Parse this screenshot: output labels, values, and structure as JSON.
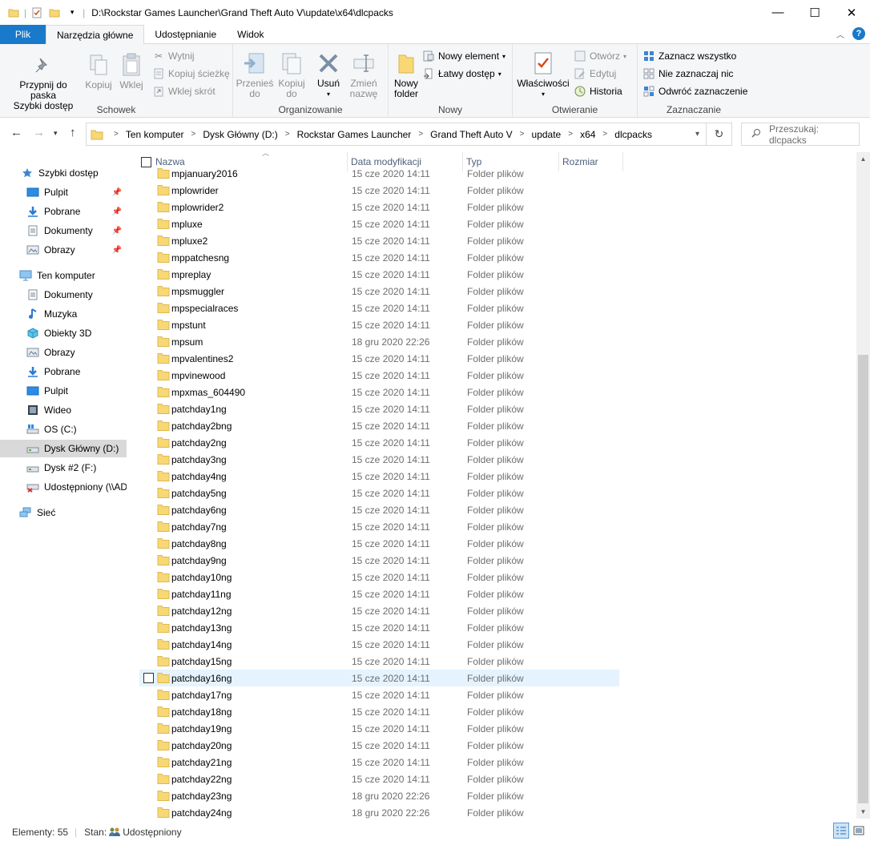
{
  "window": {
    "title": "D:\\Rockstar Games Launcher\\Grand Theft Auto V\\update\\x64\\dlcpacks",
    "controls": {
      "minimize": "—",
      "maximize": "☐",
      "close": "✕"
    }
  },
  "ribbon_tabs": [
    {
      "label": "Plik"
    },
    {
      "label": "Narzędzia główne"
    },
    {
      "label": "Udostępnianie"
    },
    {
      "label": "Widok"
    }
  ],
  "ribbon": {
    "schowek": {
      "label": "Schowek",
      "pin_line1": "Przypnij do paska",
      "pin_line2": "Szybki dostęp",
      "copy": "Kopiuj",
      "paste": "Wklej",
      "cut": "Wytnij",
      "copy_path": "Kopiuj ścieżkę",
      "paste_shortcut": "Wklej skrót"
    },
    "organizowanie": {
      "label": "Organizowanie",
      "move_line1": "Przenieś",
      "move_line2": "do",
      "copy_line1": "Kopiuj",
      "copy_line2": "do",
      "delete": "Usuń",
      "rename_line1": "Zmień",
      "rename_line2": "nazwę"
    },
    "nowy": {
      "label": "Nowy",
      "new_folder_line1": "Nowy",
      "new_folder_line2": "folder",
      "new_item": "Nowy element",
      "easy_access": "Łatwy dostęp"
    },
    "otwieranie": {
      "label": "Otwieranie",
      "properties": "Właściwości",
      "open": "Otwórz",
      "edit": "Edytuj",
      "history": "Historia"
    },
    "zaznaczanie": {
      "label": "Zaznaczanie",
      "select_all": "Zaznacz wszystko",
      "select_none": "Nie zaznaczaj nic",
      "invert": "Odwróć zaznaczenie"
    }
  },
  "address": {
    "crumbs": [
      "Ten komputer",
      "Dysk Główny (D:)",
      "Rockstar Games Launcher",
      "Grand Theft Auto V",
      "update",
      "x64",
      "dlcpacks"
    ],
    "search_placeholder": "Przeszukaj: dlcpacks"
  },
  "nav": {
    "quick_access": "Szybki dostęp",
    "quick_items": [
      "Pulpit",
      "Pobrane",
      "Dokumenty",
      "Obrazy"
    ],
    "this_pc": "Ten komputer",
    "pc_items": [
      "Dokumenty",
      "Muzyka",
      "Obiekty 3D",
      "Obrazy",
      "Pobrane",
      "Pulpit",
      "Wideo",
      "OS (C:)",
      "Dysk Główny (D:)",
      "Dysk #2 (F:)",
      "Udostępniony (\\\\AD"
    ],
    "network": "Sieć"
  },
  "columns": {
    "name": "Nazwa",
    "date": "Data modyfikacji",
    "type": "Typ",
    "size": "Rozmiar"
  },
  "files": [
    {
      "name": "mpjanuary2016",
      "date": "15 cze 2020 14:11",
      "type": "Folder plików"
    },
    {
      "name": "mplowrider",
      "date": "15 cze 2020 14:11",
      "type": "Folder plików"
    },
    {
      "name": "mplowrider2",
      "date": "15 cze 2020 14:11",
      "type": "Folder plików"
    },
    {
      "name": "mpluxe",
      "date": "15 cze 2020 14:11",
      "type": "Folder plików"
    },
    {
      "name": "mpluxe2",
      "date": "15 cze 2020 14:11",
      "type": "Folder plików"
    },
    {
      "name": "mppatchesng",
      "date": "15 cze 2020 14:11",
      "type": "Folder plików"
    },
    {
      "name": "mpreplay",
      "date": "15 cze 2020 14:11",
      "type": "Folder plików"
    },
    {
      "name": "mpsmuggler",
      "date": "15 cze 2020 14:11",
      "type": "Folder plików"
    },
    {
      "name": "mpspecialraces",
      "date": "15 cze 2020 14:11",
      "type": "Folder plików"
    },
    {
      "name": "mpstunt",
      "date": "15 cze 2020 14:11",
      "type": "Folder plików"
    },
    {
      "name": "mpsum",
      "date": "18 gru 2020 22:26",
      "type": "Folder plików"
    },
    {
      "name": "mpvalentines2",
      "date": "15 cze 2020 14:11",
      "type": "Folder plików"
    },
    {
      "name": "mpvinewood",
      "date": "15 cze 2020 14:11",
      "type": "Folder plików"
    },
    {
      "name": "mpxmas_604490",
      "date": "15 cze 2020 14:11",
      "type": "Folder plików"
    },
    {
      "name": "patchday1ng",
      "date": "15 cze 2020 14:11",
      "type": "Folder plików"
    },
    {
      "name": "patchday2bng",
      "date": "15 cze 2020 14:11",
      "type": "Folder plików"
    },
    {
      "name": "patchday2ng",
      "date": "15 cze 2020 14:11",
      "type": "Folder plików"
    },
    {
      "name": "patchday3ng",
      "date": "15 cze 2020 14:11",
      "type": "Folder plików"
    },
    {
      "name": "patchday4ng",
      "date": "15 cze 2020 14:11",
      "type": "Folder plików"
    },
    {
      "name": "patchday5ng",
      "date": "15 cze 2020 14:11",
      "type": "Folder plików"
    },
    {
      "name": "patchday6ng",
      "date": "15 cze 2020 14:11",
      "type": "Folder plików"
    },
    {
      "name": "patchday7ng",
      "date": "15 cze 2020 14:11",
      "type": "Folder plików"
    },
    {
      "name": "patchday8ng",
      "date": "15 cze 2020 14:11",
      "type": "Folder plików"
    },
    {
      "name": "patchday9ng",
      "date": "15 cze 2020 14:11",
      "type": "Folder plików"
    },
    {
      "name": "patchday10ng",
      "date": "15 cze 2020 14:11",
      "type": "Folder plików"
    },
    {
      "name": "patchday11ng",
      "date": "15 cze 2020 14:11",
      "type": "Folder plików"
    },
    {
      "name": "patchday12ng",
      "date": "15 cze 2020 14:11",
      "type": "Folder plików"
    },
    {
      "name": "patchday13ng",
      "date": "15 cze 2020 14:11",
      "type": "Folder plików"
    },
    {
      "name": "patchday14ng",
      "date": "15 cze 2020 14:11",
      "type": "Folder plików"
    },
    {
      "name": "patchday15ng",
      "date": "15 cze 2020 14:11",
      "type": "Folder plików"
    },
    {
      "name": "patchday16ng",
      "date": "15 cze 2020 14:11",
      "type": "Folder plików",
      "hover": true
    },
    {
      "name": "patchday17ng",
      "date": "15 cze 2020 14:11",
      "type": "Folder plików"
    },
    {
      "name": "patchday18ng",
      "date": "15 cze 2020 14:11",
      "type": "Folder plików"
    },
    {
      "name": "patchday19ng",
      "date": "15 cze 2020 14:11",
      "type": "Folder plików"
    },
    {
      "name": "patchday20ng",
      "date": "15 cze 2020 14:11",
      "type": "Folder plików"
    },
    {
      "name": "patchday21ng",
      "date": "15 cze 2020 14:11",
      "type": "Folder plików"
    },
    {
      "name": "patchday22ng",
      "date": "15 cze 2020 14:11",
      "type": "Folder plików"
    },
    {
      "name": "patchday23ng",
      "date": "18 gru 2020 22:26",
      "type": "Folder plików"
    },
    {
      "name": "patchday24ng",
      "date": "18 gru 2020 22:26",
      "type": "Folder plików"
    }
  ],
  "status": {
    "items": "Elementy: 55",
    "state_label": "Stan:",
    "state_value": "Udostępniony"
  },
  "colors": {
    "accent": "#1979ca",
    "folder": "#f8d775",
    "hover_row": "#e5f3ff",
    "selected_nav": "#d9d9d9"
  }
}
